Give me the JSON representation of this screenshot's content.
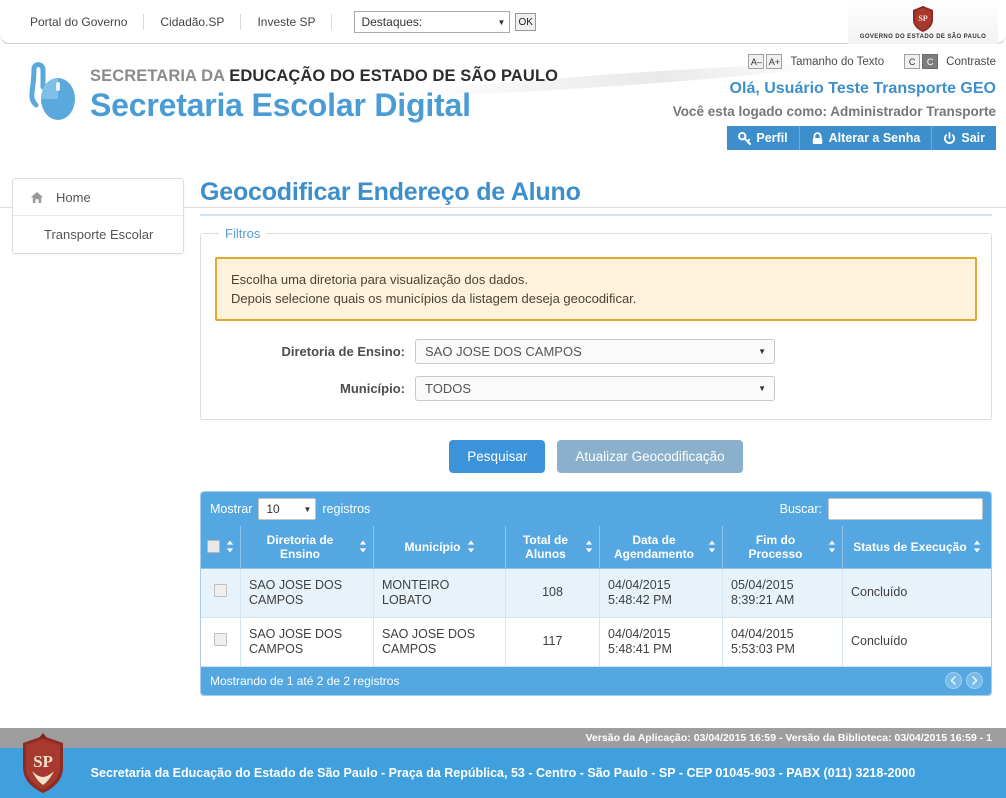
{
  "govbar": {
    "links": [
      "Portal do Governo",
      "Cidadão.SP",
      "Investe SP"
    ],
    "destaques_label": "Destaques:",
    "ok_label": "OK",
    "brand_caption": "GOVERNO DO ESTADO DE SÃO PAULO"
  },
  "header": {
    "logo_thin": "SECRETARIA DA ",
    "logo_bold": "EDUCAÇÃO DO ESTADO DE SÃO PAULO",
    "logo_main": "Secretaria Escolar Digital",
    "text_size_minus": "A–",
    "text_size_plus": "A+",
    "text_size_label": "Tamanho do Texto",
    "contrast_light": "C",
    "contrast_dark": "C",
    "contrast_label": "Contraste",
    "greeting": "Olá, Usuário Teste Transporte GEO",
    "logged_as": "Você esta logado como: Administrador Transporte",
    "buttons": [
      {
        "label": "Perfil",
        "icon": "key-icon"
      },
      {
        "label": "Alterar a Senha",
        "icon": "lock-icon"
      },
      {
        "label": "Sair",
        "icon": "power-icon"
      }
    ]
  },
  "sidebar": {
    "items": [
      {
        "label": "Home",
        "icon": "home-icon"
      },
      {
        "label": "Transporte Escolar",
        "icon": ""
      }
    ]
  },
  "main": {
    "page_title": "Geocodificar Endereço de Aluno",
    "fieldset_legend": "Filtros",
    "alert_line1": "Escolha uma diretoria para visualização dos dados.",
    "alert_line2": "Depois selecione quais os municípios da listagem deseja geocodificar.",
    "fields": [
      {
        "label": "Diretoria de Ensino:",
        "value": "SAO JOSE DOS CAMPOS"
      },
      {
        "label": "Município:",
        "value": "TODOS"
      }
    ],
    "buttons": {
      "search": "Pesquisar",
      "update": "Atualizar Geocodificação"
    }
  },
  "table": {
    "show_prefix": "Mostrar",
    "page_length": "10",
    "show_suffix": "registros",
    "search_label": "Buscar:",
    "search_value": "",
    "search_placeholder": "",
    "columns": [
      "",
      "Diretoria de Ensino",
      "Município",
      "Total de Alunos",
      "Data de Agendamento",
      "Fim do Processo",
      "Status de Execução"
    ],
    "rows": [
      {
        "diretoria": "SAO JOSE DOS CAMPOS",
        "municipio": "MONTEIRO LOBATO",
        "total_alunos": "108",
        "data_agendamento": "04/04/2015 5:48:42 PM",
        "fim_processo": "05/04/2015 8:39:21 AM",
        "status": "Concluído"
      },
      {
        "diretoria": "SAO JOSE DOS CAMPOS",
        "municipio": "SAO JOSE DOS CAMPOS",
        "total_alunos": "117",
        "data_agendamento": "04/04/2015 5:48:41 PM",
        "fim_processo": "04/04/2015 5:53:03 PM",
        "status": "Concluído"
      }
    ],
    "info": "Mostrando de 1 até 2 de 2 registros",
    "prev_icon": "arrow-left-icon",
    "next_icon": "arrow-right-icon"
  },
  "footer": {
    "version": "Versão da Aplicação: 03/04/2015 16:59  -  Versão da Biblioteca: 03/04/2015 16:59   -   1",
    "address": "Secretaria da Educação do Estado de São Paulo - Praça da República, 53 - Centro - São Paulo - SP - CEP 01045-903 - PABX (011) 3218-2000"
  },
  "colors": {
    "brand_blue": "#3d8fcc",
    "table_blue": "#54a7e0",
    "alert_border": "#e0a82e",
    "alert_bg": "#fdf3dd",
    "footer_blue": "#3fa0dd",
    "version_gray": "#9e9e9e"
  }
}
